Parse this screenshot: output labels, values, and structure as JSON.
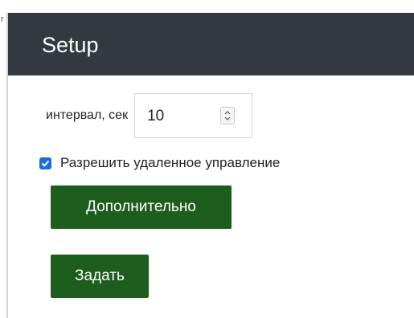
{
  "header": {
    "title": "Setup"
  },
  "left_edge": {
    "glyph": "r"
  },
  "interval": {
    "label": "интервал, сек",
    "value": "10"
  },
  "remote_control": {
    "label": "Разрешить удаленное управление",
    "checked": true
  },
  "buttons": {
    "advanced_label": "Дополнительно",
    "set_label": "Задать"
  },
  "colors": {
    "header_bg": "#343a40",
    "button_bg": "#1d5e1f",
    "checkbox_accent": "#1a6fd6"
  }
}
